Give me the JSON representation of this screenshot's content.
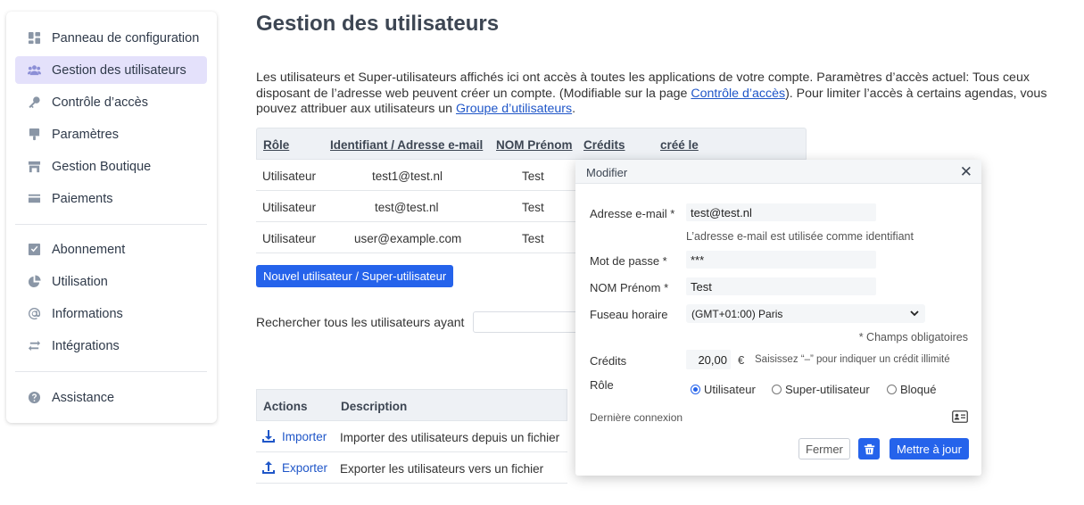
{
  "sidebar": {
    "items": [
      {
        "label": "Panneau de configuration",
        "icon": "dashboard-icon"
      },
      {
        "label": "Gestion des utilisateurs",
        "icon": "users-icon",
        "active": true
      },
      {
        "label": "Contrôle d’accès",
        "icon": "key-icon"
      },
      {
        "label": "Paramètres",
        "icon": "brush-icon"
      },
      {
        "label": "Gestion Boutique",
        "icon": "shop-icon"
      },
      {
        "label": "Paiements",
        "icon": "card-icon"
      },
      {
        "label": "Abonnement",
        "icon": "check-square-icon"
      },
      {
        "label": "Utilisation",
        "icon": "pie-chart-icon"
      },
      {
        "label": "Informations",
        "icon": "at-icon"
      },
      {
        "label": "Intégrations",
        "icon": "swap-icon"
      },
      {
        "label": "Assistance",
        "icon": "help-icon"
      }
    ]
  },
  "page": {
    "title": "Gestion des utilisateurs",
    "intro_1": "Les utilisateurs et Super-utilisateurs affichés ici ont accès à toutes les applications de votre compte. Paramètres d’accès actuel: Tous ceux disposant de l’adresse web peuvent créer un compte. (Modifiable sur la page ",
    "intro_link_1": "Contrôle d’accès",
    "intro_2": "). Pour limiter l’accès à certains agendas, vous pouvez attribuer aux utilisateurs un ",
    "intro_link_2": "Groupe d’utilisateurs",
    "intro_3": "."
  },
  "users_table": {
    "headers": [
      "Rôle",
      "Identifiant / Adresse e-mail",
      "NOM Prénom",
      "Crédits",
      "créé le"
    ],
    "rows": [
      {
        "role": "Utilisateur",
        "email": "test1@test.nl",
        "name": "Test"
      },
      {
        "role": "Utilisateur",
        "email": "test@test.nl",
        "name": "Test"
      },
      {
        "role": "Utilisateur",
        "email": "user@example.com",
        "name": "Test"
      }
    ]
  },
  "new_user_button": "Nouvel utilisateur / Super-utilisateur",
  "search": {
    "label": "Rechercher tous les utilisateurs ayant",
    "value": ""
  },
  "actions_table": {
    "headers": [
      "Actions",
      "Description"
    ],
    "rows": [
      {
        "action": "Importer",
        "icon": "download-icon",
        "description": "Importer des utilisateurs depuis un fichier"
      },
      {
        "action": "Exporter",
        "icon": "upload-icon",
        "description": "Exporter les utilisateurs vers un fichier"
      }
    ]
  },
  "modal": {
    "title": "Modifier",
    "close": "✕",
    "email_label": "Adresse e-mail *",
    "email_value": "test@test.nl",
    "email_help": "L’adresse e-mail est utilisée comme identifiant",
    "password_label": "Mot de passe *",
    "password_value": "***",
    "name_label": "NOM Prénom *",
    "name_value": "Test",
    "timezone_label": "Fuseau horaire",
    "timezone_value": "(GMT+01:00) Paris",
    "required_note": "* Champs obligatoires",
    "credits_label": "Crédits",
    "credits_value": "20,00",
    "currency": "€",
    "credits_help": "Saisissez “–” pour indiquer un crédit illimité",
    "role_label": "Rôle",
    "roles": [
      {
        "label": "Utilisateur",
        "selected": true
      },
      {
        "label": "Super-utilisateur",
        "selected": false
      },
      {
        "label": "Bloqué",
        "selected": false
      }
    ],
    "last_login_label": "Dernière connexion",
    "close_button": "Fermer",
    "update_button": "Mettre à jour"
  },
  "colors": {
    "accent": "#2563eb",
    "active_bg": "#e4e1fb",
    "link": "#1f56c8"
  }
}
